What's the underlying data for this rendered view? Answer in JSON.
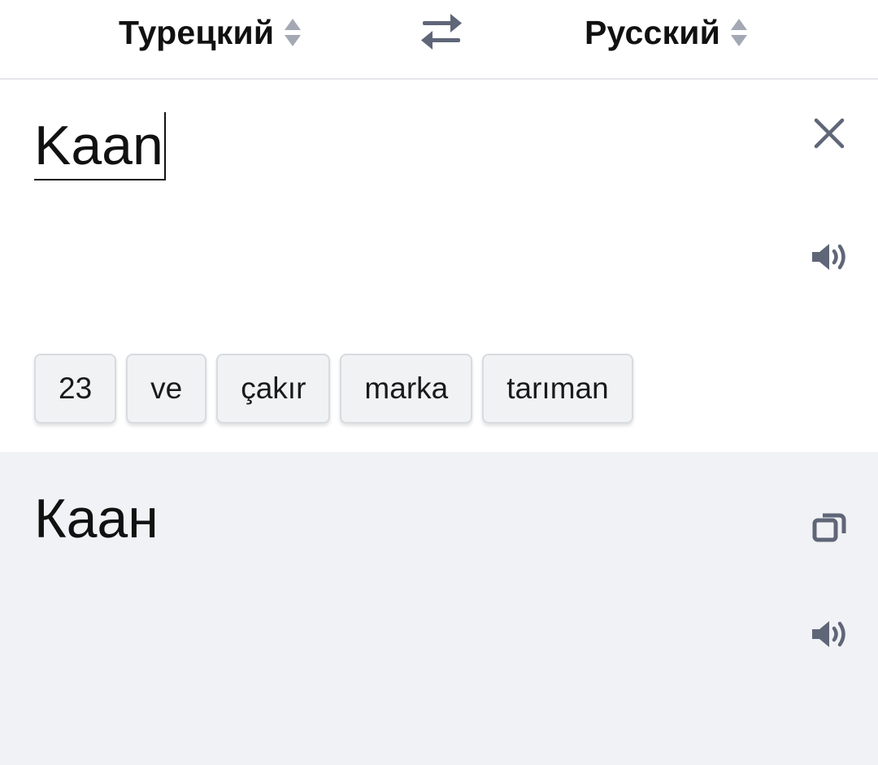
{
  "languages": {
    "source": "Турецкий",
    "target": "Русский"
  },
  "input": {
    "text": "Kaan"
  },
  "suggestions": [
    "23",
    "ve",
    "çakır",
    "marka",
    "tarıman"
  ],
  "translation": {
    "text": "Каан"
  },
  "icons": {
    "sort": "sort-updown-icon",
    "swap": "swap-arrows-icon",
    "clear": "close-icon",
    "speak": "speaker-icon",
    "copy": "copy-icon"
  },
  "colors": {
    "icon": "#5f6678",
    "sort_icon": "#a3a8b4",
    "translation_bg": "#f1f2f5",
    "chip_bg": "#f1f2f4"
  }
}
